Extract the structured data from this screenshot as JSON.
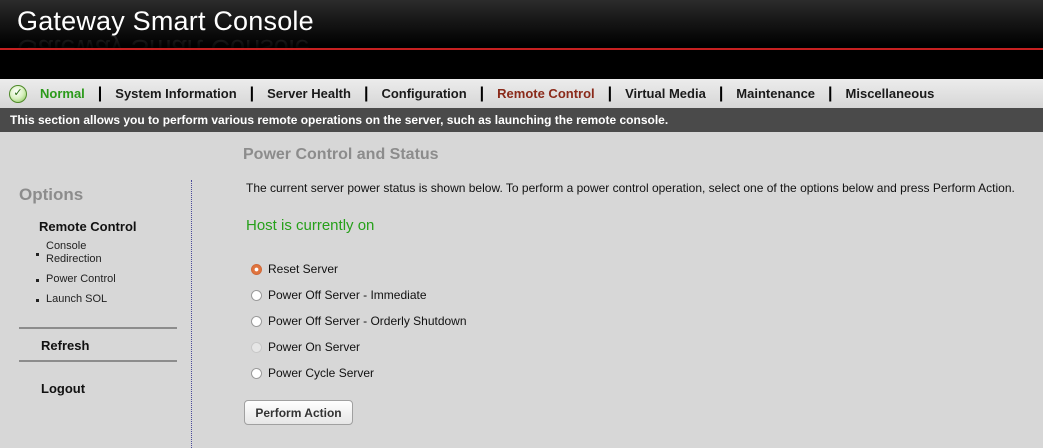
{
  "app": {
    "title": "Gateway Smart Console"
  },
  "status": {
    "label": "Normal",
    "icon": "checkmark-circle-icon",
    "color": "#2b9a1a"
  },
  "nav": {
    "items": [
      {
        "label": "System Information"
      },
      {
        "label": "Server Health"
      },
      {
        "label": "Configuration"
      },
      {
        "label": "Remote Control",
        "active": true
      },
      {
        "label": "Virtual Media"
      },
      {
        "label": "Maintenance"
      },
      {
        "label": "Miscellaneous"
      }
    ],
    "separator": "|"
  },
  "infobar": {
    "text": "This section allows you to perform various remote operations on the server, such as launching the remote console."
  },
  "sidebar": {
    "heading": "Options",
    "section": "Remote Control",
    "items": [
      {
        "label": "Console Redirection"
      },
      {
        "label": "Power Control"
      },
      {
        "label": "Launch SOL"
      }
    ],
    "refresh": "Refresh",
    "logout": "Logout"
  },
  "main": {
    "title": "Power Control and Status",
    "description": "The current server power status is shown below. To perform a power control operation, select one of the options below and press Perform Action.",
    "host_status": "Host is currently on",
    "options": [
      {
        "label": "Reset Server",
        "checked": true,
        "disabled": false
      },
      {
        "label": "Power Off Server - Immediate",
        "checked": false,
        "disabled": false
      },
      {
        "label": "Power Off Server - Orderly Shutdown",
        "checked": false,
        "disabled": false
      },
      {
        "label": "Power On Server",
        "checked": false,
        "disabled": true
      },
      {
        "label": "Power Cycle Server",
        "checked": false,
        "disabled": false
      }
    ],
    "button": "Perform Action"
  },
  "colors": {
    "accent_red": "#c62020",
    "active_nav": "#8a2a1a",
    "host_on": "#26a01a",
    "infobar_bg": "#4a4a4a"
  }
}
